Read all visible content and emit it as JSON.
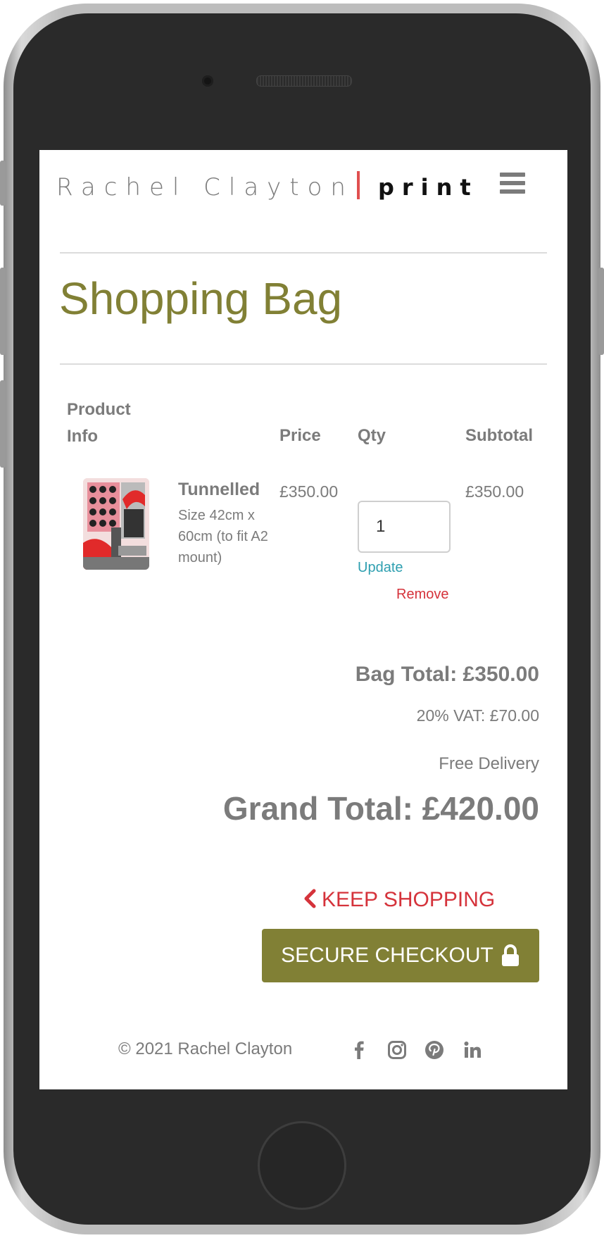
{
  "header": {
    "logo_name": "Rachel Clayton",
    "logo_print": "print",
    "menu_icon": "hamburger-icon"
  },
  "page": {
    "title": "Shopping Bag"
  },
  "table": {
    "headers": {
      "product_line1": "Product",
      "product_line2": "Info",
      "price": "Price",
      "qty": "Qty",
      "subtotal": "Subtotal"
    },
    "rows": [
      {
        "name": "Tunnelled",
        "size": "Size 42cm x 60cm (to fit A2 mount)",
        "price": "£350.00",
        "qty": "1",
        "subtotal": "£350.00",
        "update_label": "Update",
        "remove_label": "Remove"
      }
    ]
  },
  "totals": {
    "bag_total": "Bag Total: £350.00",
    "vat": "20% VAT: £70.00",
    "delivery": "Free Delivery",
    "grand_total": "Grand Total: £420.00"
  },
  "actions": {
    "keep_shopping": "KEEP SHOPPING",
    "secure_checkout": "SECURE CHECKOUT"
  },
  "footer": {
    "copyright": "© 2021 Rachel Clayton",
    "social": [
      "facebook-icon",
      "instagram-icon",
      "pinterest-icon",
      "linkedin-icon"
    ]
  },
  "colors": {
    "accent": "#818035",
    "danger": "#d5333b",
    "link": "#2e9fb0",
    "text": "#7b7b7b"
  }
}
